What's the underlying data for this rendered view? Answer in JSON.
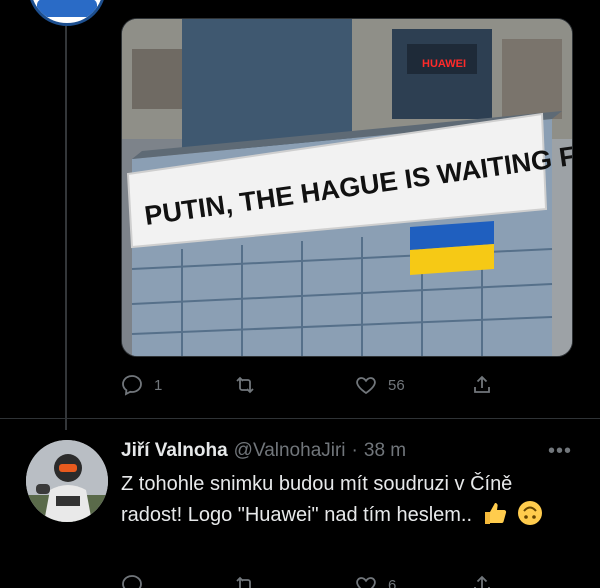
{
  "tweet": {
    "image": {
      "banner_text": "PUTIN, THE HAGUE IS WAITING FOR YOU",
      "logo_text": "HUAWEI"
    },
    "actions": {
      "reply_count": "1",
      "retweet_count": "",
      "like_count": "56"
    }
  },
  "reply": {
    "name": "Jiří Valnoha",
    "handle": "@ValnohaJiri",
    "separator": "·",
    "time": "38 m",
    "text": "Z tohohle snimku budou mít soudruzi v Číně radost! Logo \"Huawei\" nad tím heslem..",
    "emojis": [
      "thumbs-up-icon",
      "upside-down-face-icon"
    ],
    "actions": {
      "reply_count": "",
      "retweet_count": "",
      "like_count": "6"
    }
  },
  "colors": {
    "background": "#000000",
    "text": "#e7e9ea",
    "muted": "#71767b",
    "divider": "#2f3336",
    "flag_blue": "#1f5fbf",
    "flag_yellow": "#f6c915"
  }
}
